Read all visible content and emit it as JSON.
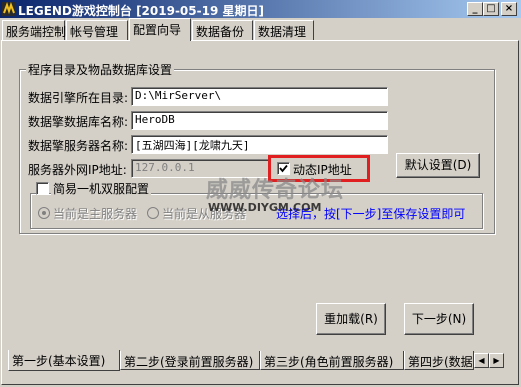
{
  "window": {
    "title": "LEGEND游戏控制台 [2019-05-19 星期日]",
    "minimize_glyph": "_",
    "maximize_glyph": "□",
    "close_glyph": "×"
  },
  "top_tabs": [
    "服务端控制",
    "帐号管理",
    "配置向导",
    "数据备份",
    "数据清理"
  ],
  "active_top_tab": "配置向导",
  "group_main": {
    "title": "程序目录及物品数据库设置",
    "fields": {
      "engine_dir": {
        "label": "数据引擎所在目录:",
        "value": "D:\\MirServer\\"
      },
      "db_name": {
        "label": "数据擎数据库名称:",
        "value": "HeroDB"
      },
      "server_name": {
        "label": "数据擎服务器名称:",
        "value": "[五湖四海][龙啸九天]"
      },
      "ip": {
        "label": "服务器外网IP地址:",
        "value": "127.0.0.1"
      }
    },
    "dynamic_ip": {
      "label": "动态IP地址",
      "checked": true
    },
    "default_button": "默认设置(D)"
  },
  "group_sub": {
    "title": "简易一机双服配置",
    "checked": false,
    "radio_main": "当前是主服务器",
    "radio_slave": "当前是从服务器",
    "hint": "选择后，按[下一步]至保存设置即可"
  },
  "buttons": {
    "reload": "重加载(R)",
    "next": "下一步(N)"
  },
  "watermark": {
    "line1": "威威传奇论坛",
    "line2": "WWW.DIYGM.COM"
  },
  "bottom_tabs": [
    "第一步(基本设置)",
    "第二步(登录前置服务器)",
    "第三步(角色前置服务器)",
    "第四步(数据"
  ],
  "scroll_left_glyph": "◀",
  "scroll_right_glyph": "▶",
  "colors": {
    "face": "#d4d0c8",
    "title_start": "#0a246a",
    "title_end": "#a6caf0",
    "highlight_box": "#e02020",
    "hint_text": "#0000ff"
  }
}
